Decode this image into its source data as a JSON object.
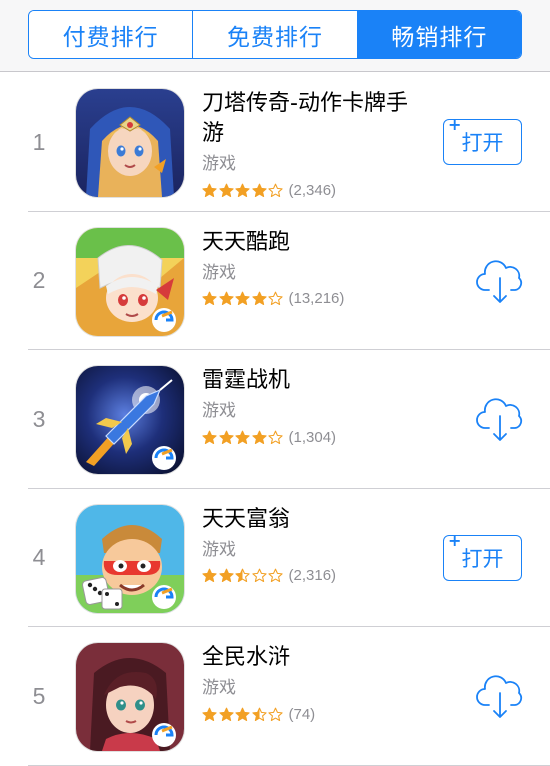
{
  "segments": [
    {
      "label": "付费排行",
      "active": false
    },
    {
      "label": "免费排行",
      "active": false
    },
    {
      "label": "畅销排行",
      "active": true
    }
  ],
  "apps": [
    {
      "rank": "1",
      "name": "刀塔传奇-动作卡牌手游",
      "category": "游戏",
      "rating": 4,
      "rating_count": "(2,346)",
      "action": "open",
      "action_label": "打开",
      "icon": "dota-legend-icon"
    },
    {
      "rank": "2",
      "name": "天天酷跑",
      "category": "游戏",
      "rating": 4,
      "rating_count": "(13,216)",
      "action": "download",
      "action_label": "",
      "icon": "tiantian-kupao-icon"
    },
    {
      "rank": "3",
      "name": "雷霆战机",
      "category": "游戏",
      "rating": 4,
      "rating_count": "(1,304)",
      "action": "download",
      "action_label": "",
      "icon": "leiting-zhanji-icon"
    },
    {
      "rank": "4",
      "name": "天天富翁",
      "category": "游戏",
      "rating": 2.5,
      "rating_count": "(2,316)",
      "action": "open",
      "action_label": "打开",
      "icon": "tiantian-fuweng-icon"
    },
    {
      "rank": "5",
      "name": "全民水浒",
      "category": "游戏",
      "rating": 3.5,
      "rating_count": "(74)",
      "action": "download",
      "action_label": "",
      "icon": "quanmin-shuihu-icon"
    }
  ],
  "colors": {
    "accent": "#1a82f7",
    "star": "#f2a024",
    "secondary_text": "#8e8e93"
  }
}
